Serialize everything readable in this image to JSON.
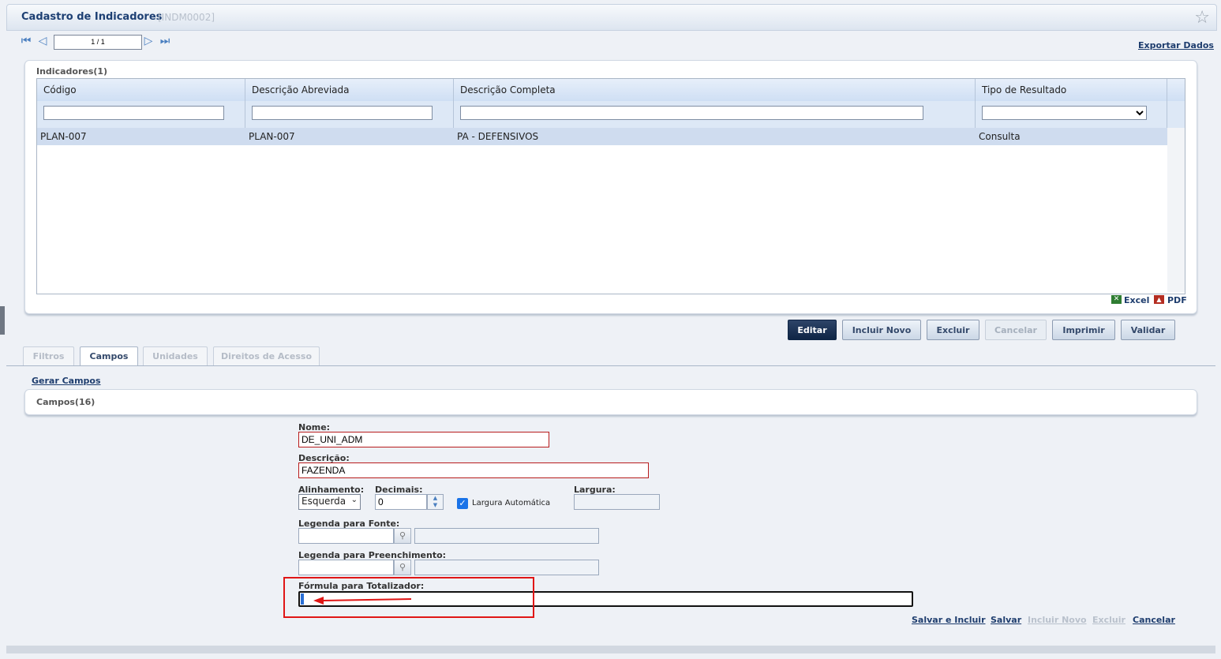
{
  "header": {
    "title": "Cadastro de Indicadores",
    "code": "[INDM0002]"
  },
  "navigation": {
    "pager_value": "1 / 1",
    "export_label": "Exportar Dados"
  },
  "grid": {
    "title": "Indicadores(1)",
    "columns": [
      "Código",
      "Descrição Abreviada",
      "Descrição Completa",
      "Tipo de Resultado"
    ],
    "rows": [
      {
        "codigo": "PLAN-007",
        "descricao_abreviada": "PLAN-007",
        "descricao_completa": "PA - DEFENSIVOS",
        "tipo_resultado": "Consulta"
      }
    ],
    "excel_label": "Excel",
    "pdf_label": "PDF"
  },
  "actions": {
    "editar": "Editar",
    "incluir_novo": "Incluir Novo",
    "excluir": "Excluir",
    "cancelar": "Cancelar",
    "imprimir": "Imprimir",
    "validar": "Validar"
  },
  "tabs": [
    {
      "label": "Filtros",
      "active": false
    },
    {
      "label": "Campos",
      "active": true
    },
    {
      "label": "Unidades",
      "active": false
    },
    {
      "label": "Direitos de Acesso",
      "active": false
    }
  ],
  "campos": {
    "gerar_label": "Gerar Campos",
    "title": "Campos(16)"
  },
  "form": {
    "nome_label": "Nome:",
    "nome_value": "DE_UNI_ADM",
    "descricao_label": "Descrição:",
    "descricao_value": "FAZENDA",
    "alinhamento_label": "Alinhamento:",
    "alinhamento_value": "Esquerda",
    "decimais_label": "Decimais:",
    "decimais_value": "0",
    "largura_auto_label": "Largura Automática",
    "largura_auto_checked": true,
    "largura_label": "Largura:",
    "legenda_fonte_label": "Legenda para Fonte:",
    "legenda_preenchimento_label": "Legenda para Preenchimento:",
    "formula_label": "Fórmula para Totalizador:"
  },
  "form_actions": {
    "salvar_incluir": "Salvar e Incluir",
    "salvar": "Salvar",
    "incluir_novo": "Incluir Novo",
    "excluir": "Excluir",
    "cancelar": "Cancelar"
  },
  "colors": {
    "accent": "#1d3f73",
    "highlight": "#e01616",
    "primary_button": "#0f2545"
  }
}
